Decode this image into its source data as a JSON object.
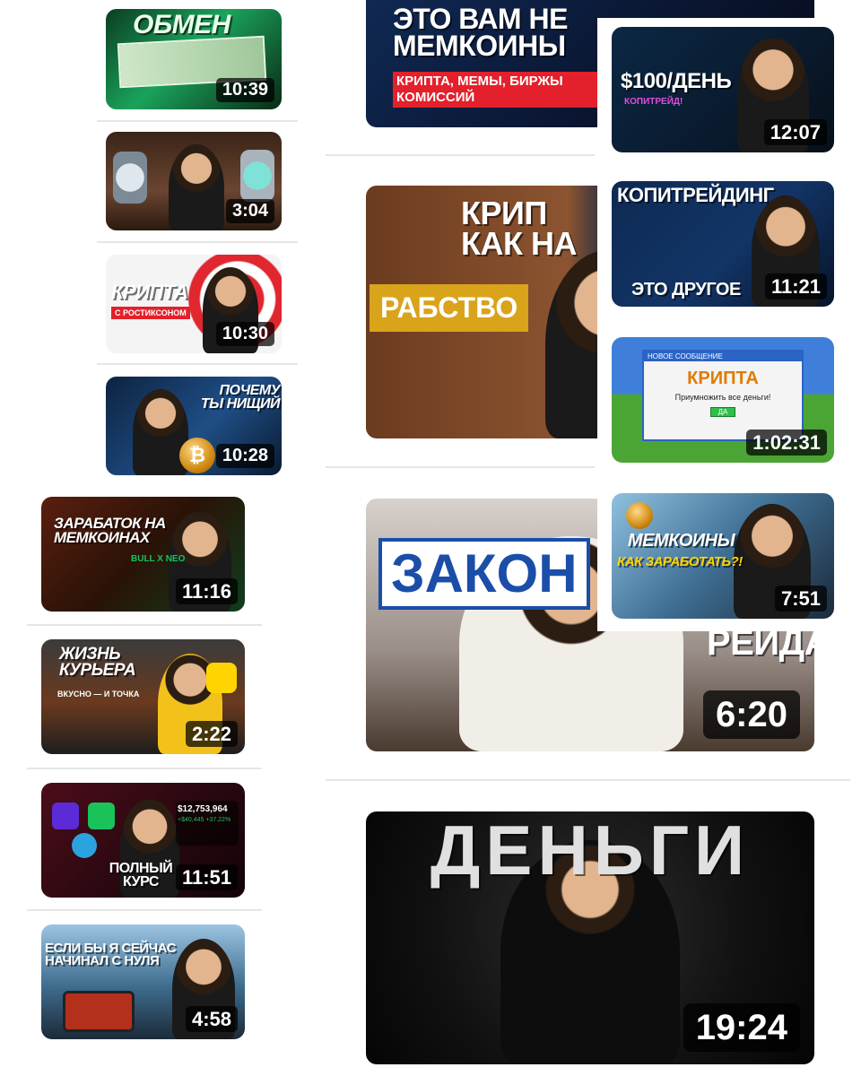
{
  "videos": {
    "v1": {
      "title": "ОБМЕН",
      "duration": "10:39"
    },
    "v2": {
      "title": "",
      "duration": "3:04"
    },
    "v3": {
      "title": "КРИПТА",
      "subtitle": "С РОСТИКСОНОМ",
      "duration": "10:30"
    },
    "v4": {
      "title": "ПОЧЕМУ ТЫ НИЩИЙ",
      "duration": "10:28"
    },
    "v5": {
      "title": "ЗАРАБАТОК НА МЕМКОИНАХ",
      "subtitle": "BULL X NEO",
      "duration": "11:16"
    },
    "v6": {
      "title": "ЖИЗНЬ КУРЬЕРА",
      "subtitle": "ВКУСНО — И ТОЧКА",
      "duration": "2:22"
    },
    "v7": {
      "title": "ПОЛНЫЙ КУРС",
      "stat_main": "$12,753,964",
      "stat_sub": "+$40,445 +37.22%",
      "duration": "11:51"
    },
    "v8": {
      "title": "ЕСЛИ БЫ Я СЕЙЧАС НАЧИНАЛ С НУЛЯ",
      "duration": "4:58"
    },
    "v9": {
      "title": "ЭТО ВАМ НЕ МЕМКОИНЫ",
      "subtitle": "КРИПТА, МЕМЫ, БИРЖЫ КОМИССИЙ"
    },
    "v10": {
      "title": "КРИП КАК НА",
      "sign": "РАБСТВО"
    },
    "v11": {
      "title": "ЗАКОН",
      "title_right": "РЕЙДА",
      "duration": "6:20"
    },
    "v12": {
      "title": "ДЕНЬГИ",
      "duration": "19:24"
    },
    "v13": {
      "title": "$100/ДЕНЬ",
      "subtitle": "КОПИТРЕЙД!",
      "duration": "12:07"
    },
    "v14": {
      "title": "КОПИТРЕЙДИНГ",
      "subtitle": "ЭТО ДРУГОЕ",
      "duration": "11:21"
    },
    "v15": {
      "window_title": "НОВОЕ СООБЩЕНИЕ",
      "title": "КРИПТА",
      "message": "Приумножить все деньги!",
      "button": "ДА",
      "duration": "1:02:31"
    },
    "v16": {
      "title": "МЕМКОИНЫ",
      "subtitle": "КАК ЗАРАБОТАТЬ?!",
      "duration": "7:51"
    }
  },
  "colors": {
    "accent_red": "#e3202b",
    "accent_green": "#19c35a",
    "accent_yellow": "#ffd400",
    "duration_bg": "rgba(0,0,0,0.72)"
  }
}
